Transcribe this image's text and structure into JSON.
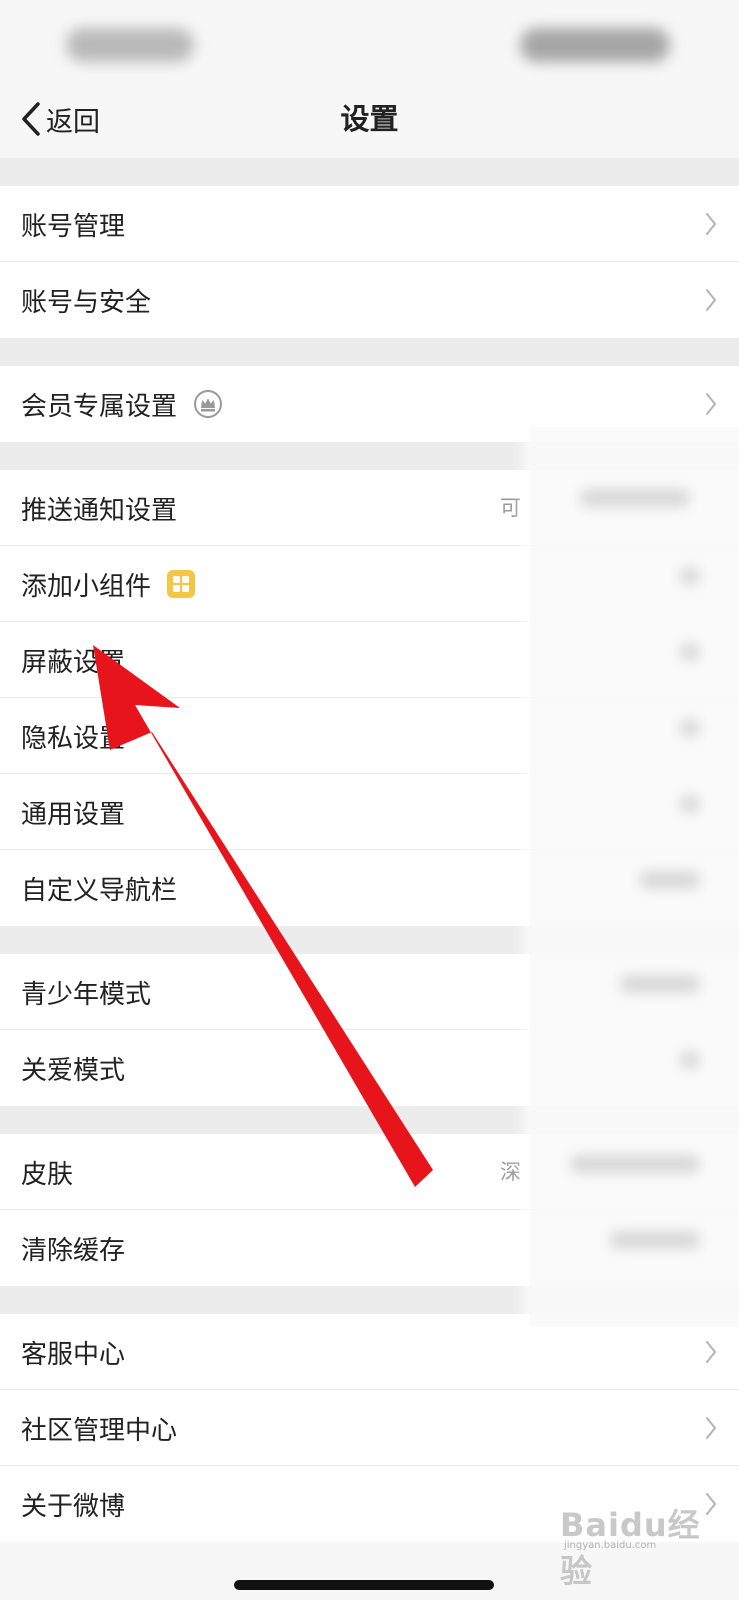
{
  "nav": {
    "back_label": "返回",
    "title": "设置"
  },
  "groups": [
    {
      "items": [
        {
          "label": "账号管理",
          "chevron": true
        },
        {
          "label": "账号与安全",
          "chevron": true
        }
      ]
    },
    {
      "items": [
        {
          "label": "会员专属设置",
          "icon": "crown-icon",
          "chevron": true
        }
      ]
    },
    {
      "items": [
        {
          "label": "推送通知设置",
          "value": "可",
          "chevron": false
        },
        {
          "label": "添加小组件",
          "icon": "widget-grid-icon",
          "chevron": false
        },
        {
          "label": "屏蔽设置",
          "chevron": false
        },
        {
          "label": "隐私设置",
          "chevron": false
        },
        {
          "label": "通用设置",
          "chevron": false
        },
        {
          "label": "自定义导航栏",
          "chevron": false
        }
      ]
    },
    {
      "items": [
        {
          "label": "青少年模式",
          "chevron": false
        },
        {
          "label": "关爱模式",
          "chevron": false
        }
      ]
    },
    {
      "items": [
        {
          "label": "皮肤",
          "value": "深",
          "chevron": false
        },
        {
          "label": "清除缓存",
          "chevron": false
        }
      ]
    },
    {
      "items": [
        {
          "label": "客服中心",
          "chevron": true
        },
        {
          "label": "社区管理中心",
          "chevron": true
        },
        {
          "label": "关于微博",
          "chevron": true
        }
      ]
    }
  ],
  "annotation": {
    "type": "red-arrow",
    "target": "屏蔽设置",
    "color": "#e8141b"
  },
  "watermark": {
    "logo": "Baidu经验",
    "url": "jingyan.baidu.com"
  },
  "colors": {
    "background": "#f7f7f7",
    "group_gap": "#ececec",
    "row_bg": "#ffffff",
    "text": "#222222",
    "secondary_text": "#999999",
    "widget_icon": "#f5c645"
  }
}
